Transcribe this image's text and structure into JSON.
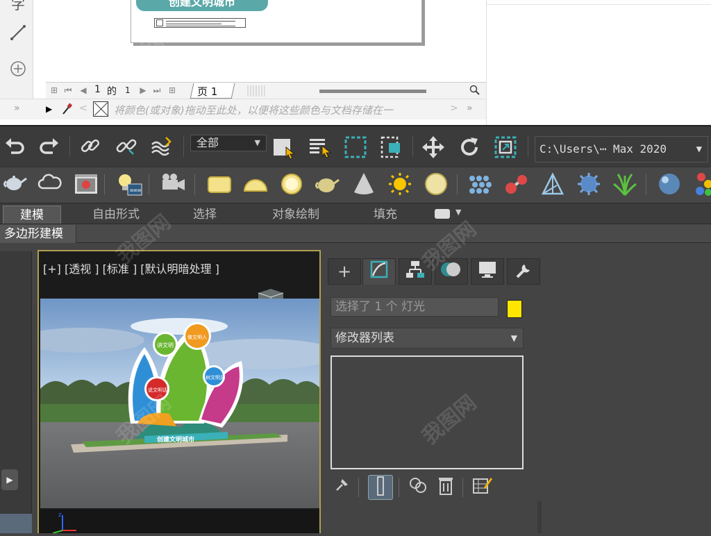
{
  "corel": {
    "doc_banner": "创建文明城市",
    "page_nav": {
      "current_page": "1",
      "of_label": "的",
      "total_pages": "1",
      "page_tab": "页 1"
    },
    "palette_hint": "将颜色(或对象)拖动至此处，以便将这些颜色与文档存储在一"
  },
  "max": {
    "selection_set": "全部",
    "project_path": "C:\\Users\\⋯ Max 2020",
    "ribbon_tabs": [
      {
        "label": "建模",
        "active": true
      },
      {
        "label": "自由形式",
        "active": false
      },
      {
        "label": "选择",
        "active": false
      },
      {
        "label": "对象绘制",
        "active": false
      },
      {
        "label": "填充",
        "active": false
      }
    ],
    "ribbon_sub_label": "多边形建模",
    "viewport_label": "[+] [透视 ] [标准 ] [默认明暗处理 ]",
    "command_panel": {
      "selection_text": "选择了 1 个 灯光",
      "selection_color": "#ffe600",
      "modifier_list": "修改器列表"
    }
  },
  "scene": {
    "petal_labels": [
      "讲文明",
      "做文明人",
      "说文明话",
      "树文明风"
    ],
    "base_sign": "创建文明城市"
  },
  "watermark": "我图网",
  "colors": {
    "viewport_border": "#b0a050",
    "accent_teal": "#3ab0b8",
    "panel_bg": "#444444"
  }
}
